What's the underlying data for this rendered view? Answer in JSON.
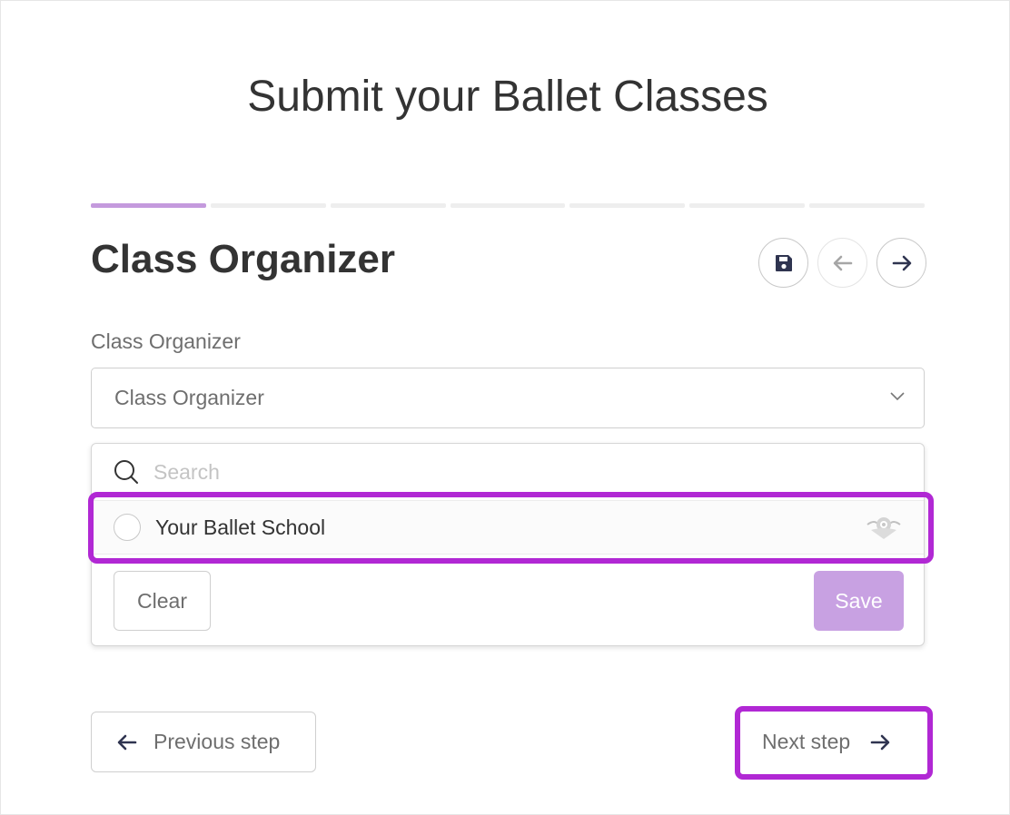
{
  "page": {
    "title": "Submit your Ballet Classes"
  },
  "progress": {
    "total_steps": 7,
    "current_step": 1
  },
  "step": {
    "title": "Class Organizer"
  },
  "field": {
    "label": "Class Organizer",
    "select_value": "Class Organizer"
  },
  "dropdown": {
    "search_placeholder": "Search",
    "options": [
      {
        "label": "Your Ballet School",
        "selected": false
      }
    ],
    "clear_label": "Clear",
    "save_label": "Save"
  },
  "footer": {
    "previous_label": "Previous step",
    "next_label": "Next step"
  },
  "colors": {
    "accent": "#c49add",
    "highlight": "#b128d4",
    "save_button": "#c8a1e2"
  },
  "icons": [
    "save-icon",
    "arrow-left-icon",
    "arrow-right-icon",
    "chevron-down-icon",
    "search-icon",
    "radio-icon",
    "school-logo-icon"
  ]
}
